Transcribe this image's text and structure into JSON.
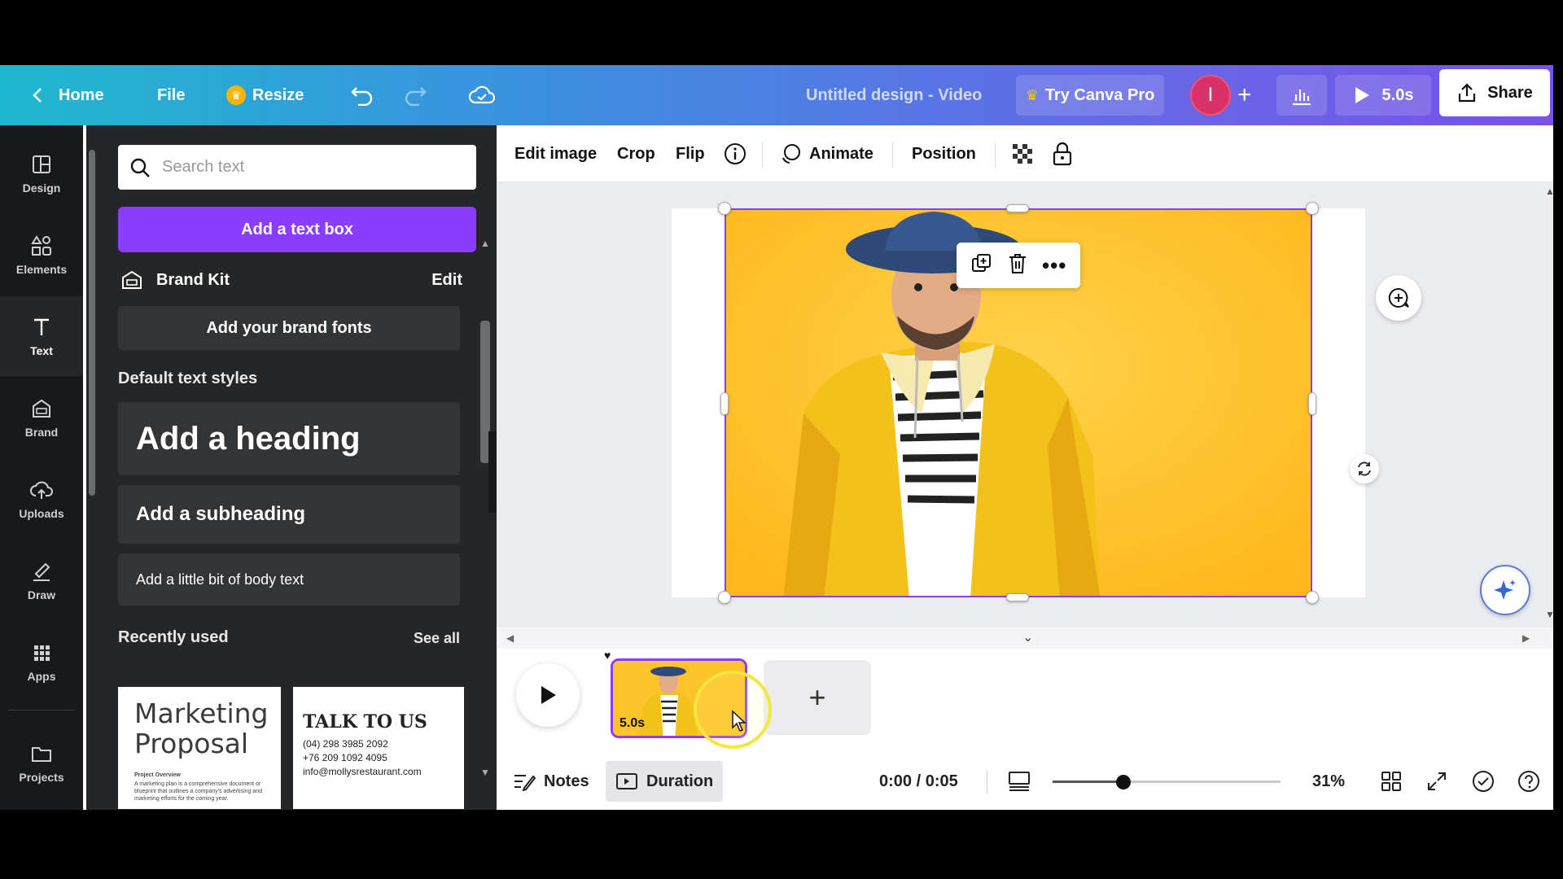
{
  "topbar": {
    "home_label": "Home",
    "file_label": "File",
    "resize_label": "Resize",
    "title": "Untitled design - Video",
    "pro_label": "Try Canva Pro",
    "avatar_initial": "I",
    "play_duration": "5.0s",
    "share_label": "Share"
  },
  "rail": {
    "items": [
      {
        "label": "Design",
        "icon": "layout-icon"
      },
      {
        "label": "Elements",
        "icon": "shapes-icon"
      },
      {
        "label": "Text",
        "icon": "text-icon"
      },
      {
        "label": "Brand",
        "icon": "brand-icon"
      },
      {
        "label": "Uploads",
        "icon": "cloud-upload-icon"
      },
      {
        "label": "Draw",
        "icon": "pen-icon"
      },
      {
        "label": "Apps",
        "icon": "grid-icon"
      },
      {
        "label": "Projects",
        "icon": "folder-icon"
      }
    ]
  },
  "panel": {
    "search_placeholder": "Search text",
    "add_text_box": "Add a text box",
    "brand_kit": "Brand Kit",
    "brand_edit": "Edit",
    "brand_fonts": "Add your brand fonts",
    "default_styles": "Default text styles",
    "heading": "Add a heading",
    "subheading": "Add a subheading",
    "body": "Add a little bit of body text",
    "recently_used": "Recently used",
    "see_all": "See all",
    "templates": [
      {
        "line1": "Marketing",
        "line2": "Proposal",
        "small_title": "Project Overview",
        "small_body": "A marketing plan is a comprehensive document or blueprint that outlines a company's advertising and marketing efforts for the coming year."
      },
      {
        "title": "TALK TO US",
        "phone1": "(04) 298 3985 2092",
        "phone2": "+76 209 1092 4095",
        "email": "info@mollysrestaurant.com"
      }
    ]
  },
  "toolbar": {
    "edit_image": "Edit image",
    "crop": "Crop",
    "flip": "Flip",
    "animate": "Animate",
    "position": "Position"
  },
  "timeline": {
    "clip_duration": "5.0s",
    "add_clip": "+",
    "notes": "Notes",
    "duration": "Duration",
    "time": "0:00 / 0:05",
    "zoom_percent": "31%",
    "zoom_fraction": 0.31
  },
  "colors": {
    "accent": "#8b3dff",
    "photo_bg": "#ffc42a",
    "panel_bg": "#252627",
    "rail_bg": "#18191b"
  }
}
